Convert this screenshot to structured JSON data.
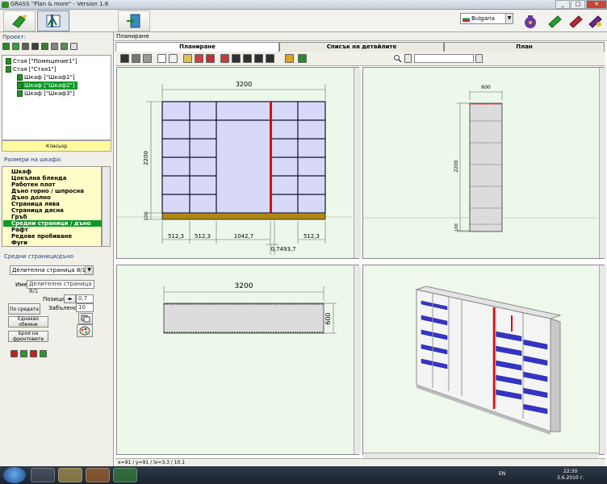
{
  "window": {
    "title": "GRASS \"Plan & more\" - Version 1.6"
  },
  "language": {
    "selected": "Bulgaria"
  },
  "left": {
    "project_label": "Проект:",
    "tree": [
      {
        "label": "Стая [\"Помещение1\"]"
      },
      {
        "label": "Стая [\"Стая1\"]"
      },
      {
        "label": "Шкаф [\"Шкаф1\"]"
      },
      {
        "label": "Шкаф [\"Шкаф2\"]"
      },
      {
        "label": "Шкаф [\"Шкаф3\"]"
      }
    ],
    "klasior": "Класьор",
    "dims_label": "Размери на шкафа:",
    "dims": [
      "Шкаф",
      "Цокълна бленда",
      "Работен плот",
      "Дъно горно / шпросна",
      "Дъно долно",
      "Страница лява",
      "Страница дясна",
      "Гръб",
      "Средни страници / дъно",
      "Рафт",
      "Редове пробиване",
      "Фуги"
    ],
    "mid_label": "Средни страници/дъно",
    "combo": "Делителна страница 8/1",
    "name_label": "Име",
    "name_value": "Делително страница 8/1",
    "position_label": "Позиция",
    "position_value": "0,7",
    "thickness_label": "Забълено",
    "thickness_value": "10",
    "btn_center": "По средата",
    "btn_even": "Еднакво обемни",
    "btn_fronts": "Броя на фронтовете"
  },
  "main": {
    "header": "Планиране",
    "tabs": [
      "Планиране",
      "Списък на детайлите",
      "План"
    ],
    "status": "x=91 / y=91 / lx=3.3 / 10.1"
  },
  "front_view": {
    "width_dim": "3200",
    "height_dim": "2200",
    "plinth_dim": "100",
    "bottom_dims": [
      "512,3",
      "512,3",
      "1042,7",
      "512,3"
    ],
    "center_dim": "0,7493,7"
  },
  "side_view": {
    "depth_dim": "600",
    "height_dim": "2200",
    "plinth_dim": "100"
  },
  "top_view": {
    "width_dim": "3200",
    "depth_dim": "600"
  },
  "taskbar": {
    "lang": "EN",
    "time": "22:30",
    "date": "3.6.2010 г."
  },
  "colors": {
    "shelf": "#d8d8f8",
    "frame": "#101030",
    "divider": "#d01010",
    "plinth": "#b08810",
    "pane_bg": "#ecf9ea",
    "highlight": "#0c9a26"
  }
}
